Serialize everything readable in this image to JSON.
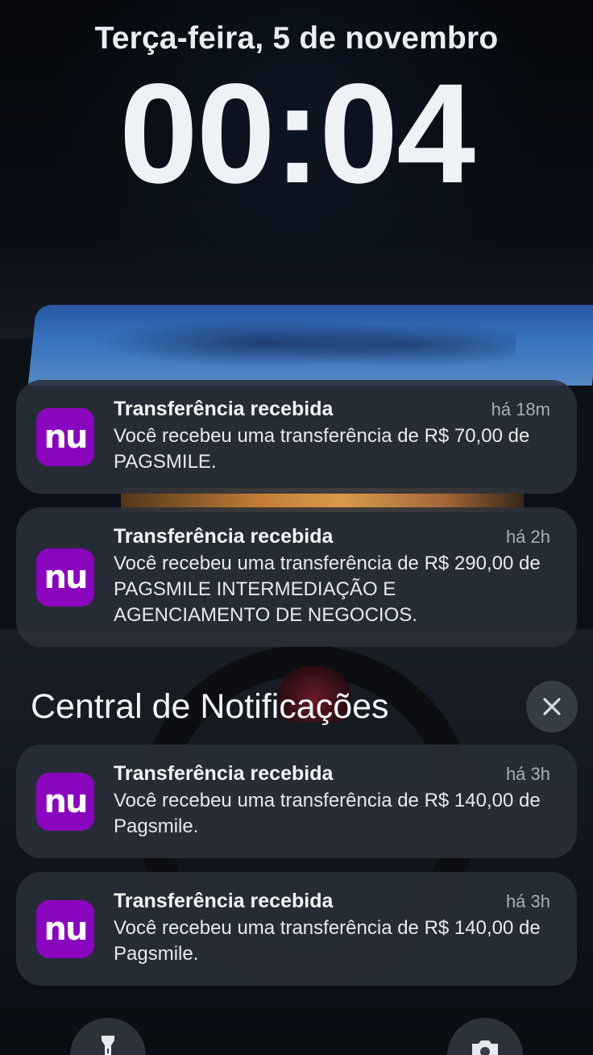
{
  "lock_screen": {
    "date": "Terça-feira, 5 de novembro",
    "time": "00:04"
  },
  "notifications_top": [
    {
      "app_icon_label": "nu",
      "title": "Transferência recebida",
      "time": "há 18m",
      "body": "Você recebeu uma transferência de R$ 70,00 de PAGSMILE."
    },
    {
      "app_icon_label": "nu",
      "title": "Transferência recebida",
      "time": "há 2h",
      "body": "Você recebeu uma transferência de R$ 290,00 de PAGSMILE INTERMEDIAÇÃO E AGENCIAMENTO DE NEGOCIOS."
    }
  ],
  "notification_center": {
    "title": "Central de Notificações",
    "items": [
      {
        "app_icon_label": "nu",
        "title": "Transferência recebida",
        "time": "há 3h",
        "body": "Você recebeu uma transferência de R$ 140,00 de Pagsmile."
      },
      {
        "app_icon_label": "nu",
        "title": "Transferência recebida",
        "time": "há 3h",
        "body": "Você recebeu uma transferência de R$ 140,00 de Pagsmile."
      }
    ]
  },
  "icons": {
    "clear": "close-icon",
    "flashlight": "flashlight-icon",
    "camera": "camera-icon"
  },
  "colors": {
    "nubank_purple": "#8a05be",
    "notification_bg": "#2a303a"
  }
}
